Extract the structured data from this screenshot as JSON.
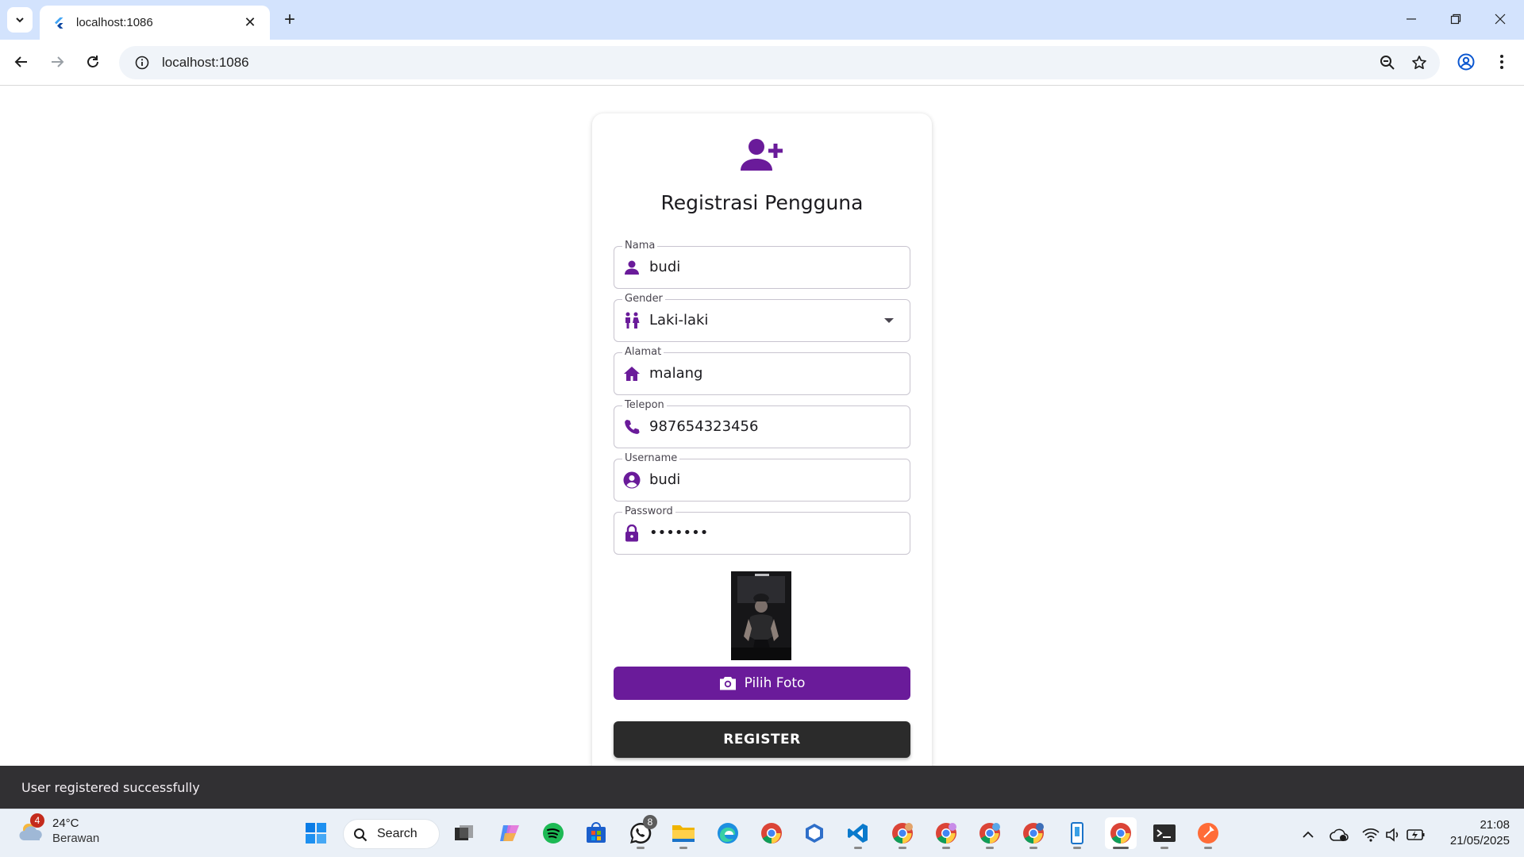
{
  "browser": {
    "tab_title": "localhost:1086",
    "url": "localhost:1086"
  },
  "form": {
    "title": "Registrasi Pengguna",
    "fields": [
      {
        "label": "Nama",
        "value": "budi",
        "icon": "person-icon"
      },
      {
        "label": "Gender",
        "value": "Laki-laki",
        "icon": "wc-icon"
      },
      {
        "label": "Alamat",
        "value": "malang",
        "icon": "home-icon"
      },
      {
        "label": "Telepon",
        "value": "987654323456",
        "icon": "phone-icon"
      },
      {
        "label": "Username",
        "value": "budi",
        "icon": "account-circle-icon"
      },
      {
        "label": "Password",
        "value": "•••••••",
        "icon": "lock-icon"
      }
    ],
    "pick_photo_label": "Pilih Foto",
    "register_label": "REGISTER"
  },
  "snackbar": {
    "message": "User registered successfully"
  },
  "taskbar": {
    "weather_badge": "4",
    "weather_temp": "24°C",
    "weather_condition": "Berawan",
    "search_label": "Search",
    "whatsapp_badge": "8",
    "time": "21:08",
    "date": "21/05/2025"
  },
  "colors": {
    "accent": "#6a1b9a",
    "register_button": "#2b2b2b",
    "snackbar": "#313033",
    "tabbar": "#d3e3fd"
  }
}
